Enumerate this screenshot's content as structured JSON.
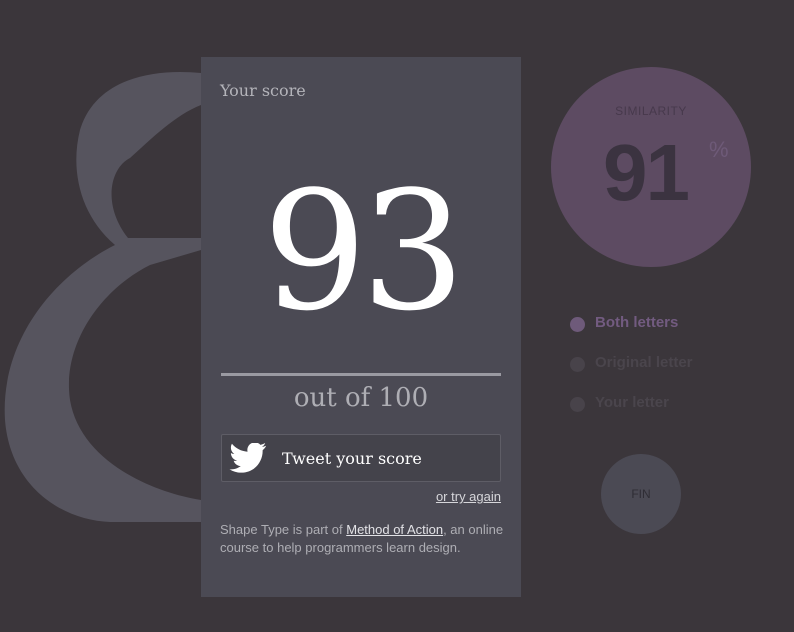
{
  "score_panel": {
    "heading": "Your score",
    "score": "93",
    "out_of": "out of 100",
    "tweet_label": "Tweet your score",
    "try_again": "or try again",
    "footer": {
      "prefix": "Shape Type is part of ",
      "link": "Method of Action",
      "suffix": ", an online course to help programmers learn design."
    }
  },
  "similarity": {
    "label": "SIMILARITY",
    "value": "91",
    "unit": "%"
  },
  "layer_options": [
    {
      "label": "Both letters",
      "active": true
    },
    {
      "label": "Original letter",
      "active": false
    },
    {
      "label": "Your letter",
      "active": false
    }
  ],
  "fin_button": {
    "label": "FIN"
  },
  "icons": {
    "tweet": "twitter-bird-icon",
    "background": "letter-glyph"
  },
  "colors": {
    "background": "#3b363b",
    "panel": "#4b4a54",
    "glyph": "#56545e",
    "accent": "#725b80",
    "similarity_circle": "#5d4b62"
  }
}
